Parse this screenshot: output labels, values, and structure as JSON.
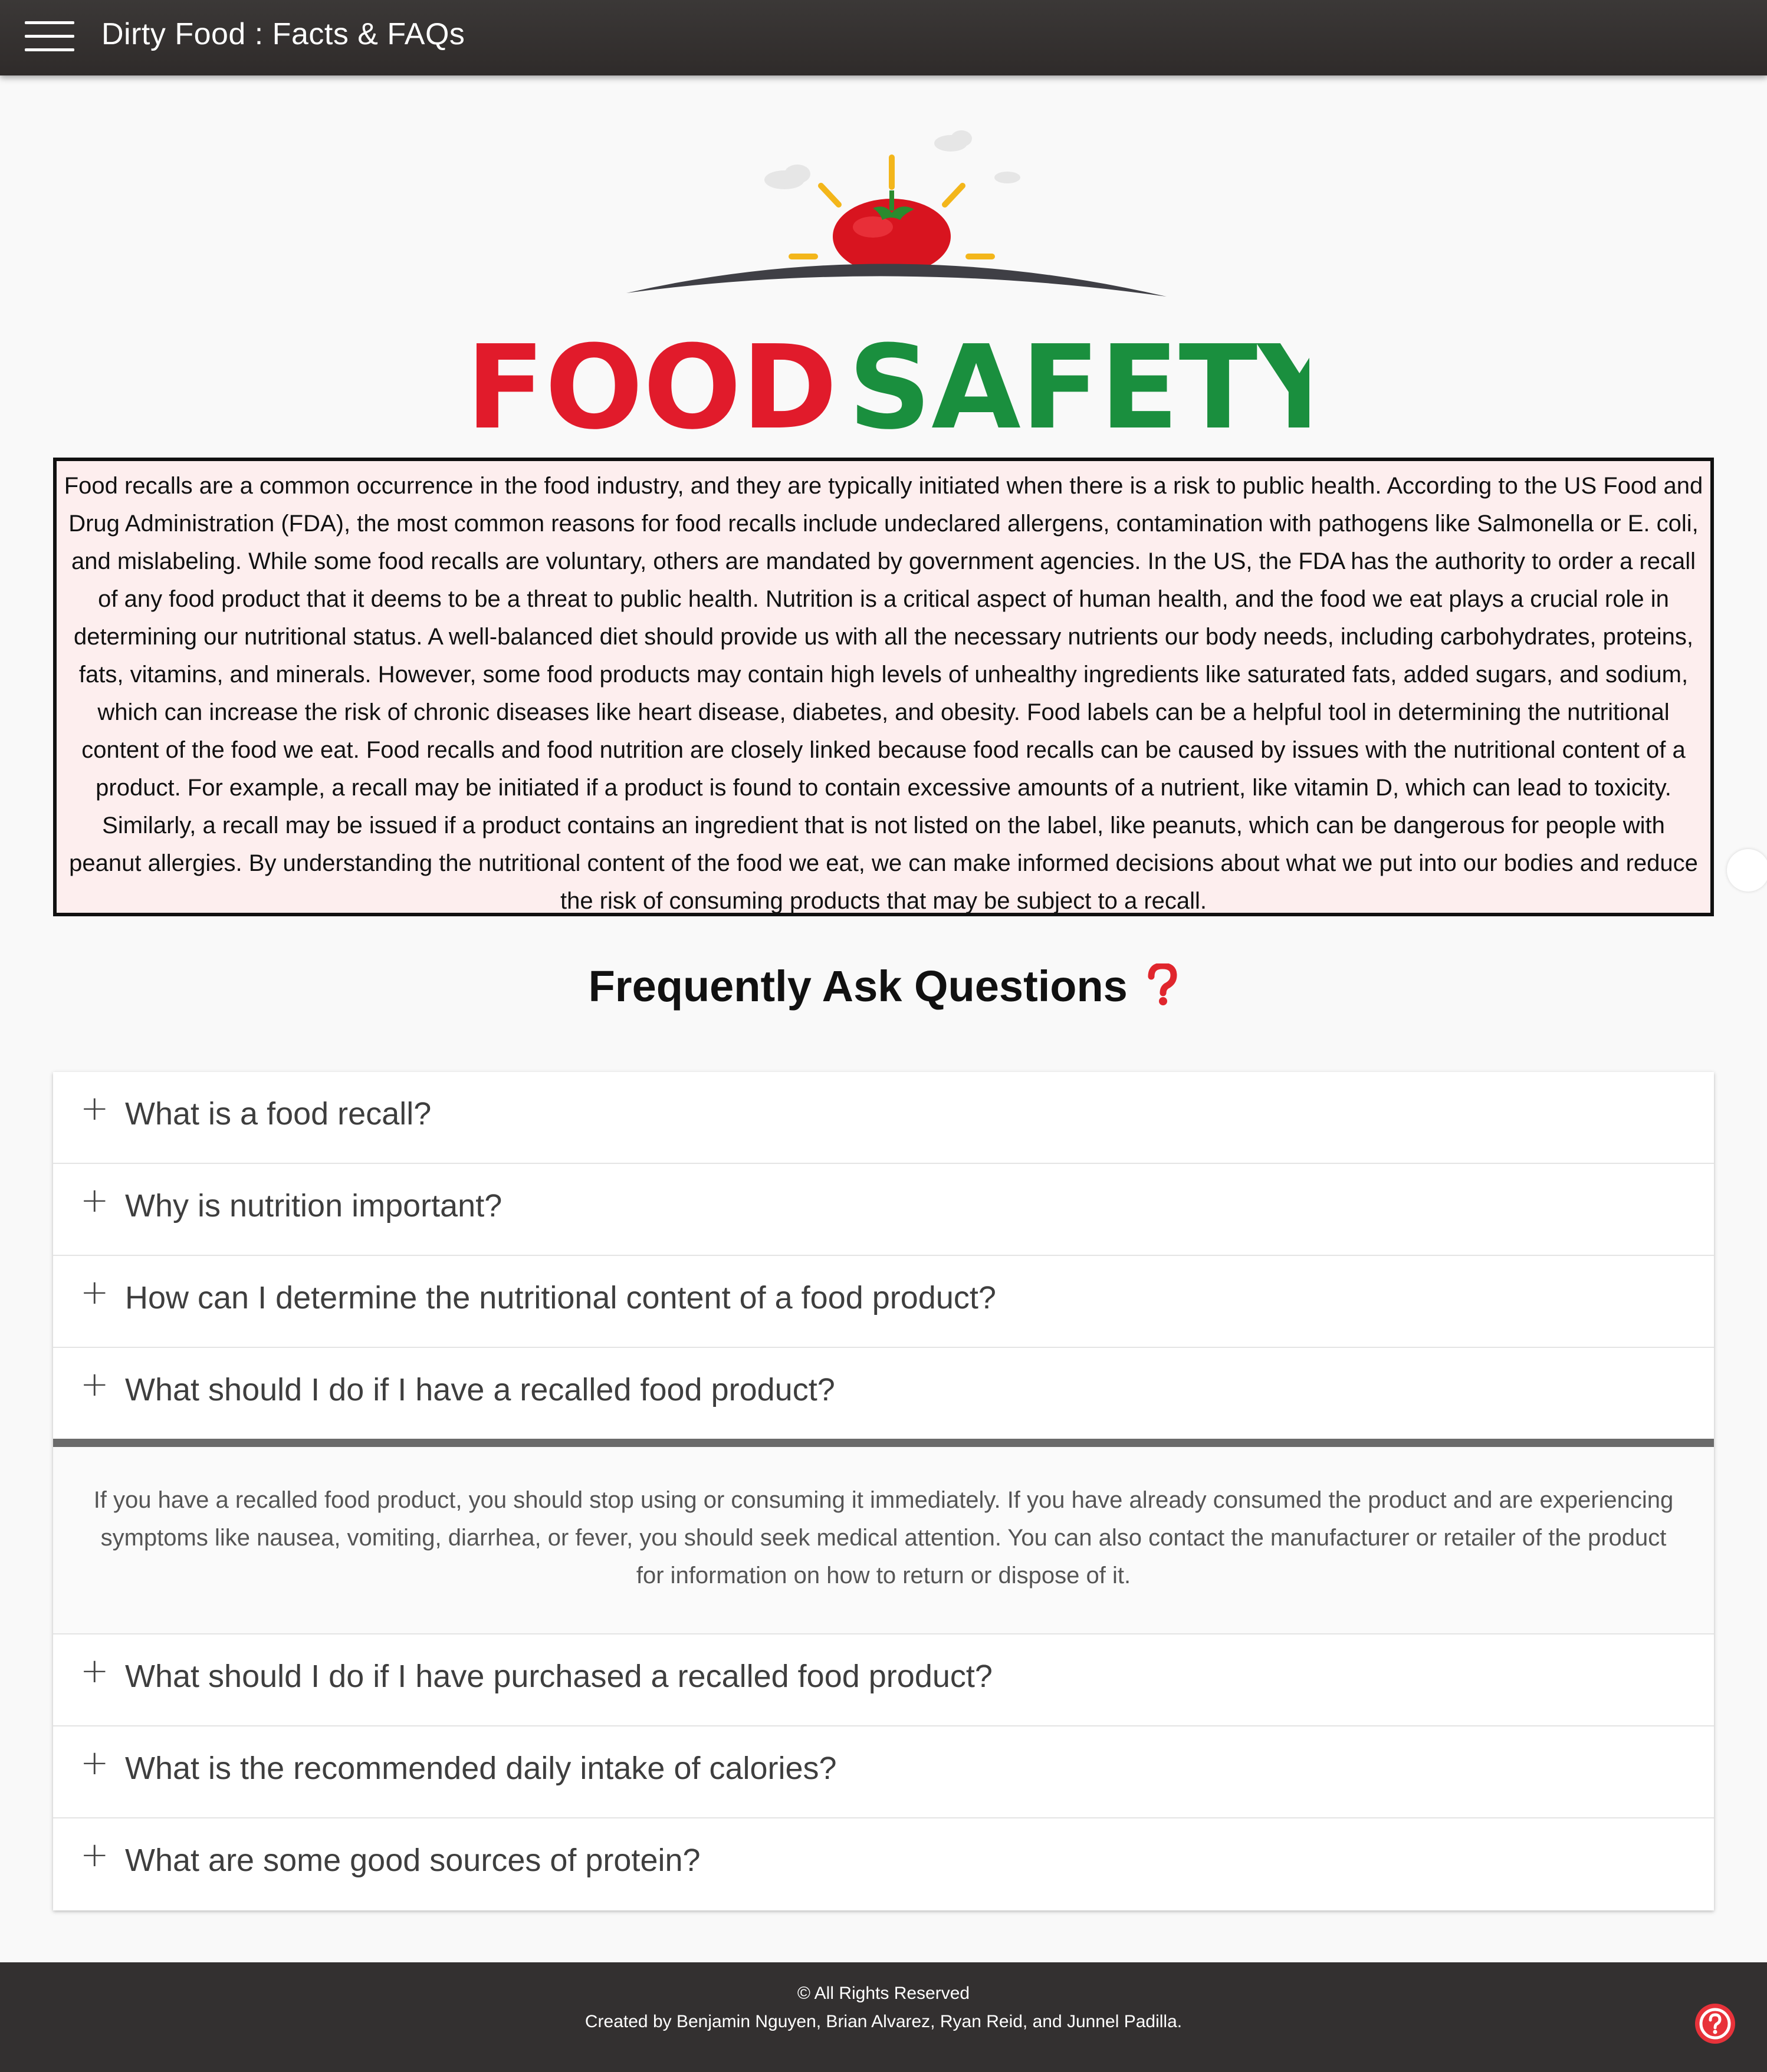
{
  "header": {
    "title": "Dirty Food : Facts & FAQs",
    "menu_icon": "hamburger-menu-icon"
  },
  "logo": {
    "word1": "FOOD",
    "word2": "SAFETY",
    "word1_color": "#e11b2b",
    "word2_color": "#1a8f3e",
    "icon": "tomato-sunrise-logo"
  },
  "intro": {
    "text": "Food recalls are a common occurrence in the food industry, and they are typically initiated when there is a risk to public health. According to the US Food and Drug Administration (FDA), the most common reasons for food recalls include undeclared allergens, contamination with pathogens like Salmonella or E. coli, and mislabeling. While some food recalls are voluntary, others are mandated by government agencies. In the US, the FDA has the authority to order a recall of any food product that it deems to be a threat to public health. Nutrition is a critical aspect of human health, and the food we eat plays a crucial role in determining our nutritional status. A well-balanced diet should provide us with all the necessary nutrients our body needs, including carbohydrates, proteins, fats, vitamins, and minerals. However, some food products may contain high levels of unhealthy ingredients like saturated fats, added sugars, and sodium, which can increase the risk of chronic diseases like heart disease, diabetes, and obesity. Food labels can be a helpful tool in determining the nutritional content of the food we eat. Food recalls and food nutrition are closely linked because food recalls can be caused by issues with the nutritional content of a product. For example, a recall may be initiated if a product is found to contain excessive amounts of a nutrient, like vitamin D, which can lead to toxicity. Similarly, a recall may be issued if a product contains an ingredient that is not listed on the label, like peanuts, which can be dangerous for people with peanut allergies. By understanding the nutritional content of the food we eat, we can make informed decisions about what we put into our bodies and reduce the risk of consuming products that may be subject to a recall."
  },
  "faq": {
    "heading": "Frequently Ask Questions",
    "heading_icon": "red-question-mark-icon",
    "items": [
      {
        "q": "What is a food recall?"
      },
      {
        "q": "Why is nutrition important?"
      },
      {
        "q": "How can I determine the nutritional content of a food product?"
      },
      {
        "q": "What should I do if I have a recalled food product?",
        "answer": "If you have a recalled food product, you should stop using or consuming it immediately. If you have already consumed the product and are experiencing symptoms like nausea, vomiting, diarrhea, or fever, you should seek medical attention. You can also contact the manufacturer or retailer of the product for information on how to return or dispose of it."
      },
      {
        "q": "What should I do if I have purchased a recalled food product?"
      },
      {
        "q": "What is the recommended daily intake of calories?"
      },
      {
        "q": "What are some good sources of protein?"
      }
    ],
    "expand_symbol": "+"
  },
  "footer": {
    "rights": "© All Rights Reserved",
    "credits": "Created by Benjamin Nguyen, Brian Alvarez, Ryan Reid, and Junnel Padilla.",
    "help_icon": "help-question-icon"
  }
}
